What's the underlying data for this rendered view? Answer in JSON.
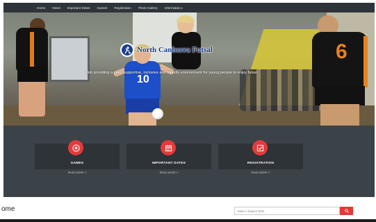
{
  "nav": {
    "items": [
      {
        "label": "Home"
      },
      {
        "label": "News"
      },
      {
        "label": "Important Dates"
      },
      {
        "label": "Games"
      },
      {
        "label": "Registration"
      },
      {
        "label": "Photo Gallery"
      },
      {
        "label": "Information"
      }
    ]
  },
  "hero": {
    "brand_name": "North Canberra Futsal",
    "tagline": "club providing a safe, supportive, inclusive and friendly environment for young people to enjoy futsal"
  },
  "cards": [
    {
      "title": "GAMES",
      "more": "READ MORE",
      "icon": "football-icon"
    },
    {
      "title": "IMPORTANT DATES",
      "more": "READ MORE",
      "icon": "calendar-icon"
    },
    {
      "title": "REGISTRATION",
      "more": "READ MORE",
      "icon": "checkbox-icon"
    }
  ],
  "page": {
    "title": "ome"
  },
  "search": {
    "placeholder": "Enter A Search Term"
  },
  "colors": {
    "accent": "#e53935",
    "nav_bg": "#2e3439",
    "panel_bg": "#3b4248",
    "card_bg": "#2e3338",
    "brand_blue": "#1d3f8f"
  }
}
